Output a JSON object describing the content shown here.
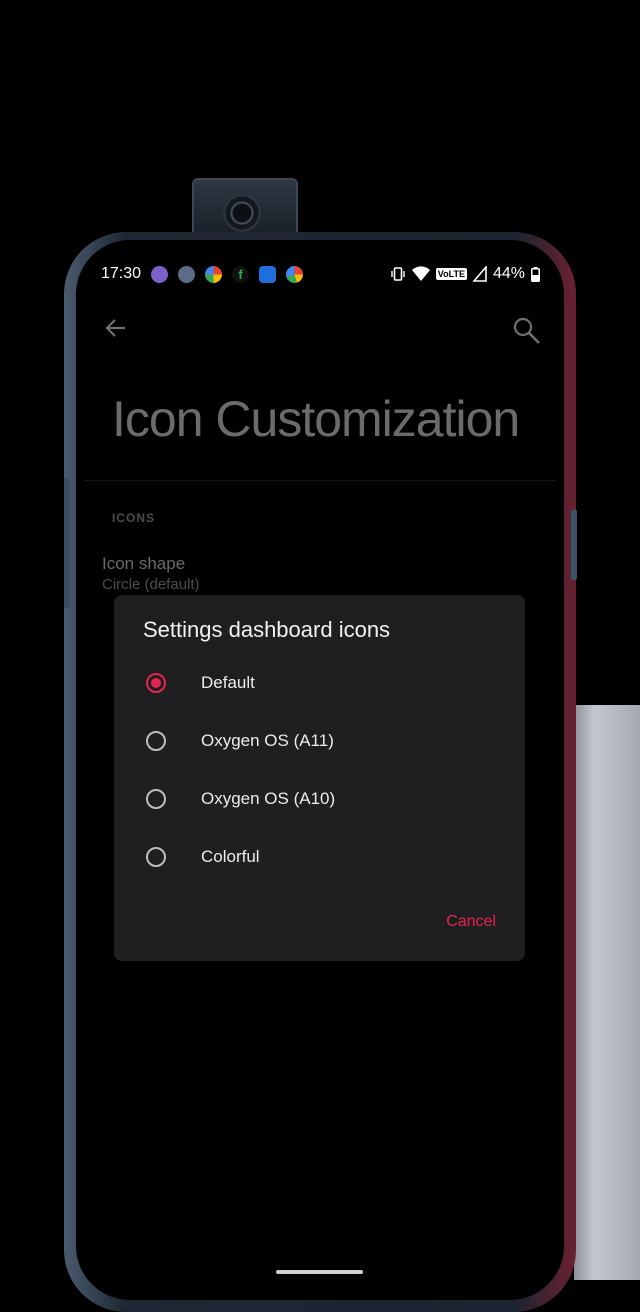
{
  "status_bar": {
    "time": "17:30",
    "notification_icons": [
      {
        "name": "viber-icon",
        "color": "#7b61c9"
      },
      {
        "name": "signal-icon",
        "color": "#5b6b88"
      },
      {
        "name": "pinwheel-icon",
        "color": "#f0b32b"
      },
      {
        "name": "feedly-icon",
        "color": "#2bb24c"
      },
      {
        "name": "gallery-icon",
        "color": "#1e6fd9"
      },
      {
        "name": "google-icon",
        "color": "#ffffff"
      }
    ],
    "volte": "VoLTE",
    "battery": "44%"
  },
  "page": {
    "title": "Icon Customization",
    "section_header": "ICONS",
    "prefs": [
      {
        "title": "Icon shape",
        "subtitle": "Circle (default)"
      }
    ]
  },
  "dialog": {
    "title": "Settings dashboard icons",
    "options": [
      {
        "label": "Default",
        "selected": true
      },
      {
        "label": "Oxygen OS (A11)",
        "selected": false
      },
      {
        "label": "Oxygen OS (A10)",
        "selected": false
      },
      {
        "label": "Colorful",
        "selected": false
      }
    ],
    "cancel_label": "Cancel",
    "accent_color": "#e5244d"
  }
}
